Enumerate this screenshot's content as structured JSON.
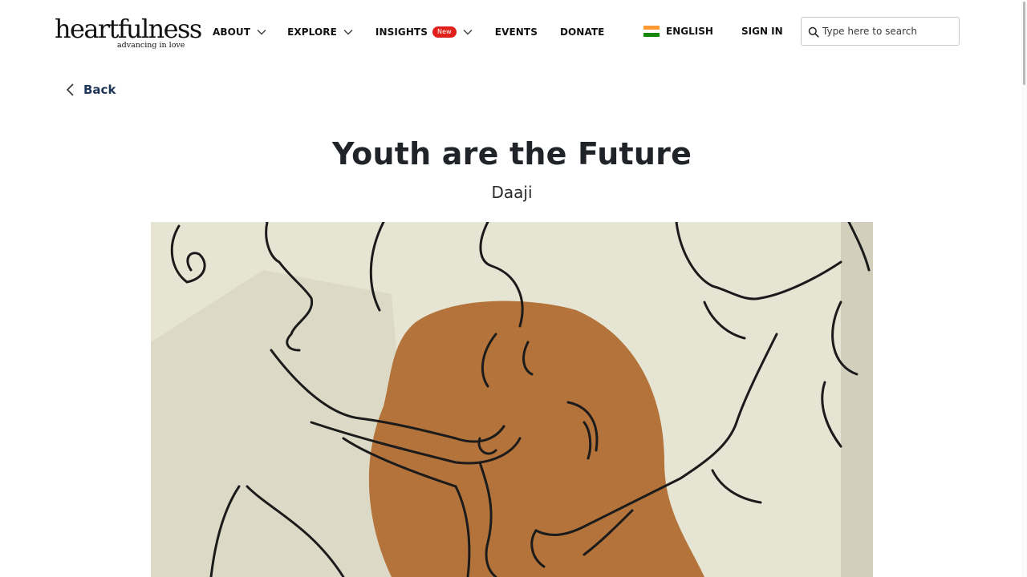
{
  "logo": {
    "wordmark": "heartfulness",
    "tagline": "advancing in love"
  },
  "nav": {
    "about": "ABOUT",
    "explore": "EXPLORE",
    "insights": "INSIGHTS",
    "insights_badge": "New",
    "events": "EVENTS",
    "donate": "DONATE"
  },
  "language": {
    "label": "ENGLISH",
    "flag_colors": [
      "#ff9933",
      "#ffffff",
      "#138808"
    ]
  },
  "signin": "SIGN IN",
  "search": {
    "placeholder": "Type here to search",
    "value": ""
  },
  "back": "Back",
  "article": {
    "title": "Youth are the Future",
    "author": "Daaji"
  },
  "colors": {
    "badge": "#e0201b",
    "back_link": "#1d3557",
    "illustration_bg": "#e6e5d3",
    "illustration_accent": "#b3733a"
  }
}
